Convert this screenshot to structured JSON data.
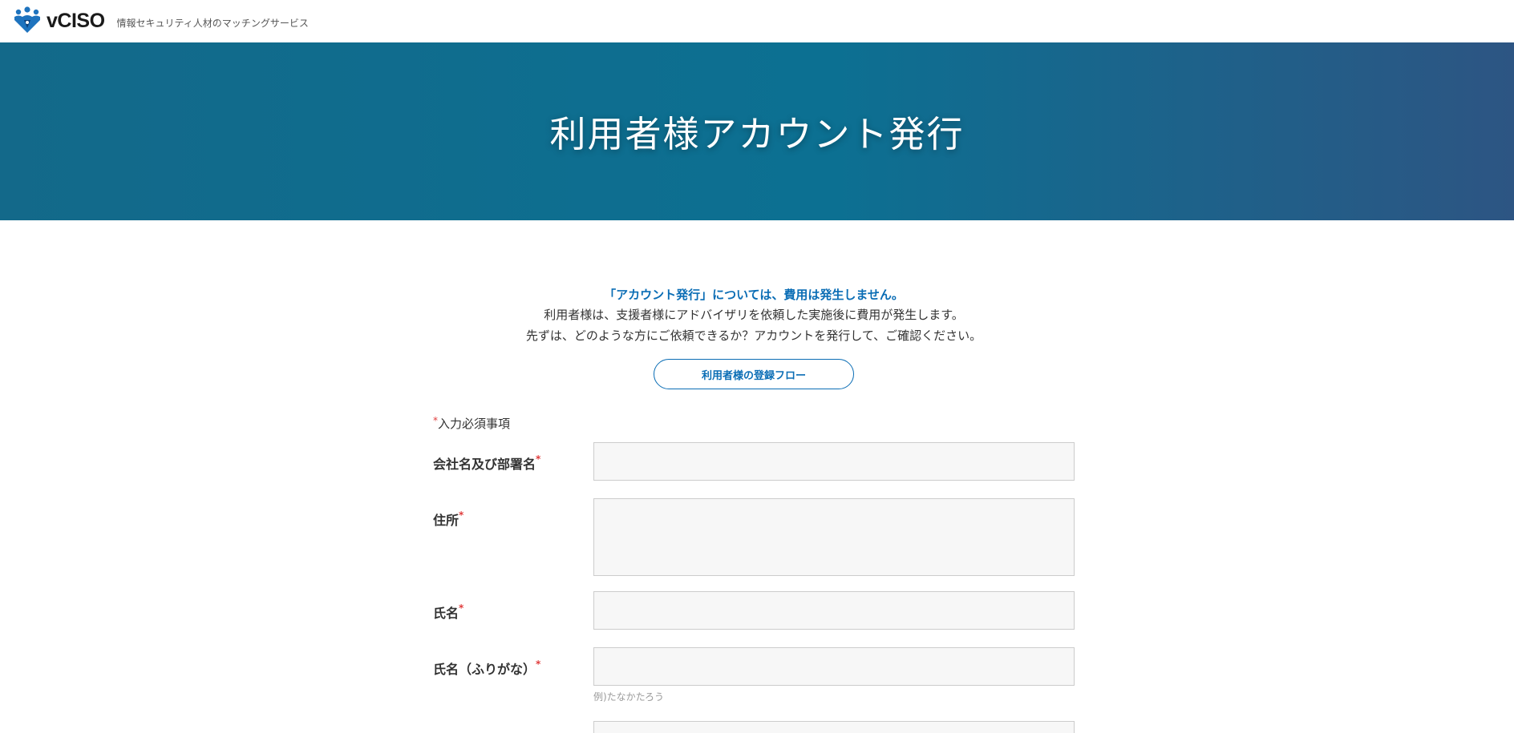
{
  "header": {
    "brand": "vCISO",
    "tagline": "情報セキュリティ人材のマッチングサービス"
  },
  "hero": {
    "title": "利用者様アカウント発行"
  },
  "intro": {
    "lead": "「アカウント発行」については、費用は発生しません。",
    "line1": "利用者様は、支援者様にアドバイザリを依頼した実施後に費用が発生します。",
    "line2": "先ずは、どのような方にご依頼できるか？アカウントを発行して、ご確認ください。"
  },
  "flow_button": {
    "label": "利用者様の登録フロー"
  },
  "form": {
    "required_mark": "*",
    "required_note": "入力必須事項",
    "fields": [
      {
        "label": "会社名及び部署名",
        "value": ""
      },
      {
        "label": "住所",
        "value": ""
      },
      {
        "label": "氏名",
        "value": ""
      },
      {
        "label": "氏名（ふりがな）",
        "value": "",
        "hint": "例)たなかたろう"
      }
    ]
  },
  "colors": {
    "accent": "#0a6db5",
    "required": "#e03c3c",
    "hero_start": "#13698a",
    "hero_end": "#2d5583"
  }
}
